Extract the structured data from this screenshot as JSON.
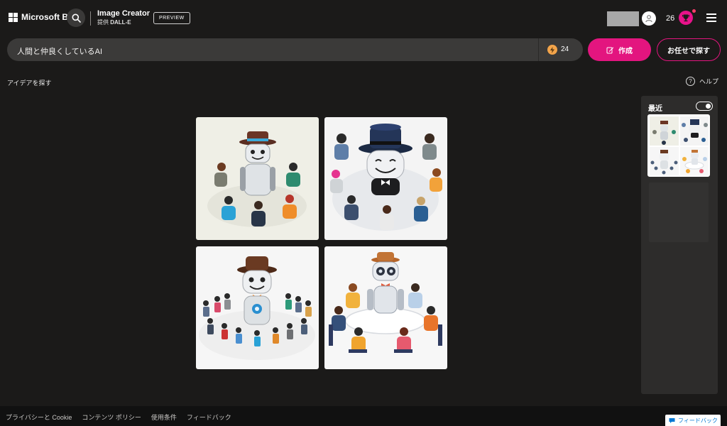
{
  "header": {
    "brand": "Microsoft Bing",
    "app_title": "Image Creator",
    "app_subtitle_prefix": "提供",
    "app_subtitle_brand": "DALL-E",
    "badge": "PREVIEW",
    "reward_count": "26"
  },
  "prompt": {
    "value": "人間と仲良くしているAI",
    "boost_count": "24",
    "create_label": "作成",
    "surprise_label": "お任せで探す"
  },
  "explore": {
    "ideas_label": "アイデアを探す",
    "help_label": "ヘルプ"
  },
  "recent": {
    "title": "最近",
    "toggle_on": true
  },
  "footer": {
    "links": [
      "プライバシーと Cookie",
      "コンテンツ ポリシー",
      "使用条件",
      "フィードバック"
    ],
    "feedback_button": "フィードバック"
  },
  "colors": {
    "accent": "#e3157f",
    "background": "#1b1a19",
    "search_bar": "#3b3a39",
    "panel": "#2d2c2b"
  }
}
